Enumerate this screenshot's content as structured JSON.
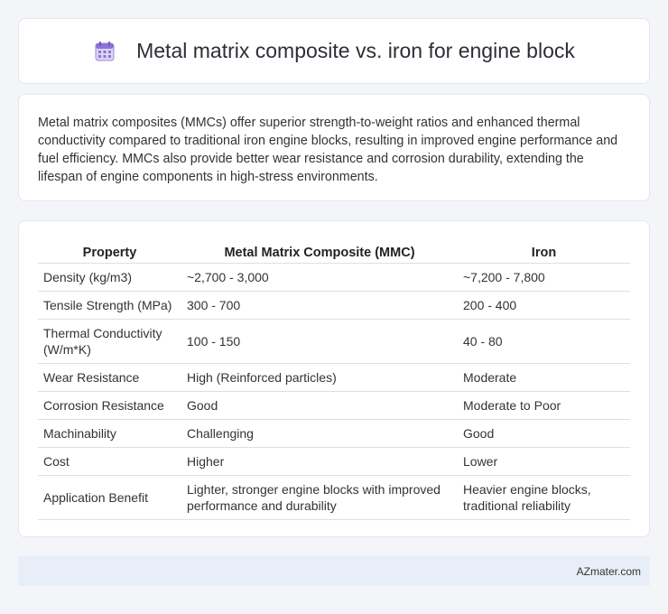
{
  "header": {
    "title": "Metal matrix composite vs. iron for engine block",
    "icon": "calendar-icon"
  },
  "intro": {
    "text": "Metal matrix composites (MMCs) offer superior strength-to-weight ratios and enhanced thermal conductivity compared to traditional iron engine blocks, resulting in improved engine performance and fuel efficiency. MMCs also provide better wear resistance and corrosion durability, extending the lifespan of engine components in high-stress environments."
  },
  "table": {
    "headers": [
      "Property",
      "Metal Matrix Composite (MMC)",
      "Iron"
    ],
    "rows": [
      [
        "Density (kg/m3)",
        "~2,700 - 3,000",
        "~7,200 - 7,800"
      ],
      [
        "Tensile Strength (MPa)",
        "300 - 700",
        "200 - 400"
      ],
      [
        "Thermal Conductivity (W/m*K)",
        "100 - 150",
        "40 - 80"
      ],
      [
        "Wear Resistance",
        "High (Reinforced particles)",
        "Moderate"
      ],
      [
        "Corrosion Resistance",
        "Good",
        "Moderate to Poor"
      ],
      [
        "Machinability",
        "Challenging",
        "Good"
      ],
      [
        "Cost",
        "Higher",
        "Lower"
      ],
      [
        "Application Benefit",
        "Lighter, stronger engine blocks with improved performance and durability",
        "Heavier engine blocks, traditional reliability"
      ]
    ]
  },
  "footer": {
    "brand": "AZmater.com"
  }
}
